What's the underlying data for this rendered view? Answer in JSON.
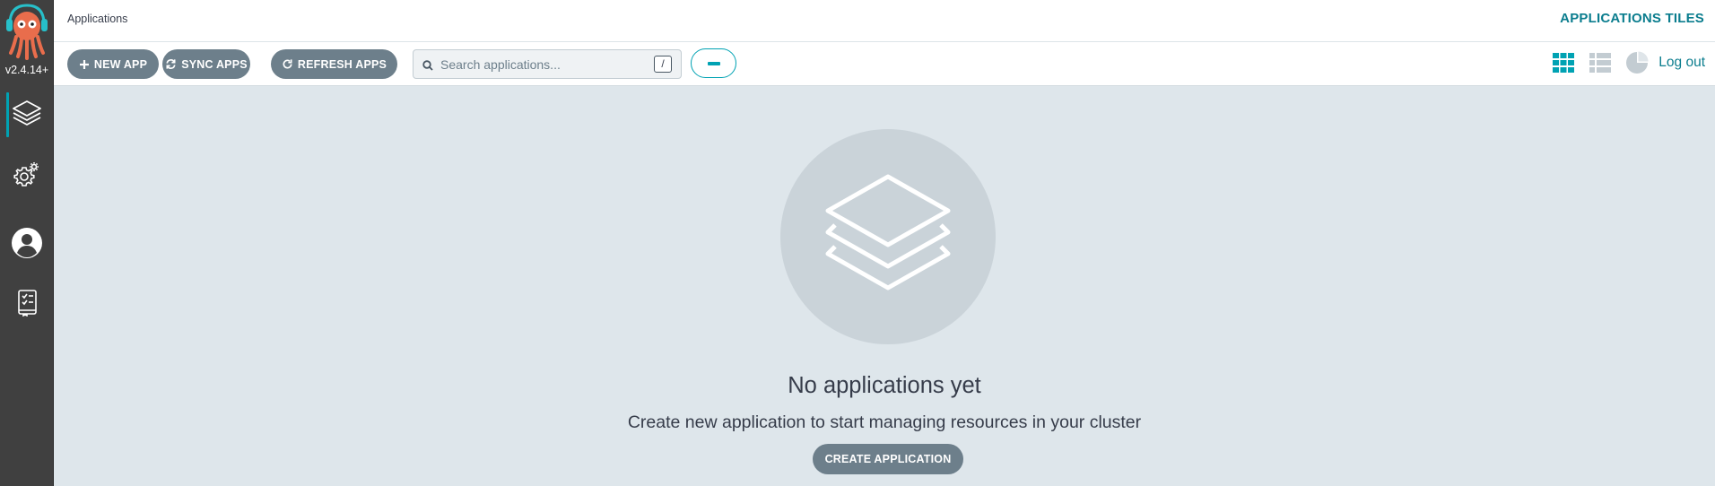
{
  "sidebar": {
    "version": "v2.4.14+",
    "items": [
      {
        "name": "applications",
        "icon": "layers-icon",
        "active": true
      },
      {
        "name": "settings",
        "icon": "gear-icon",
        "active": false
      },
      {
        "name": "user-info",
        "icon": "user-icon",
        "active": false
      },
      {
        "name": "documentation",
        "icon": "docs-icon",
        "active": false
      }
    ]
  },
  "header": {
    "breadcrumb": "Applications",
    "title": "APPLICATIONS TILES"
  },
  "toolbar": {
    "new_app_label": "NEW APP",
    "sync_apps_label": "SYNC APPS",
    "refresh_apps_label": "REFRESH APPS",
    "search_placeholder": "Search applications...",
    "search_shortcut": "/",
    "logout_label": "Log out",
    "views": [
      {
        "name": "tiles-view",
        "icon": "grid-icon",
        "active": true
      },
      {
        "name": "list-view",
        "icon": "list-icon",
        "active": false
      },
      {
        "name": "summary-view",
        "icon": "pie-chart-icon",
        "active": false
      }
    ]
  },
  "empty_state": {
    "title": "No applications yet",
    "subtitle": "Create new application to start managing resources in your cluster",
    "button_label": "CREATE APPLICATION"
  },
  "colors": {
    "accent": "#00a2b3",
    "accent_text": "#0b7d8e",
    "button": "#6d7f8b",
    "sidebar": "#404040",
    "content_bg": "#dee6eb"
  }
}
